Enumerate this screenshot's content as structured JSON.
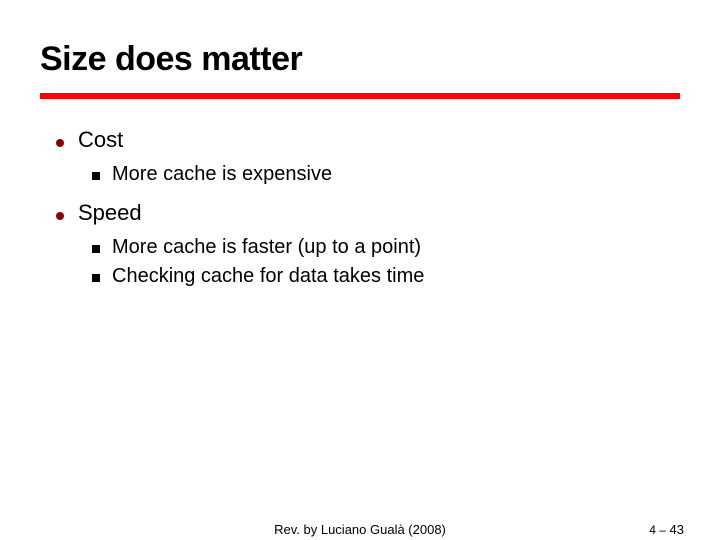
{
  "title": "Size does matter",
  "bullets": [
    {
      "label": "Cost",
      "children": [
        "More cache is expensive"
      ]
    },
    {
      "label": "Speed",
      "children": [
        "More cache is faster (up to a point)",
        "Checking cache for data takes time"
      ]
    }
  ],
  "footer": {
    "center": "Rev. by Luciano Gualà (2008)",
    "section": "4 –",
    "page": "43"
  }
}
